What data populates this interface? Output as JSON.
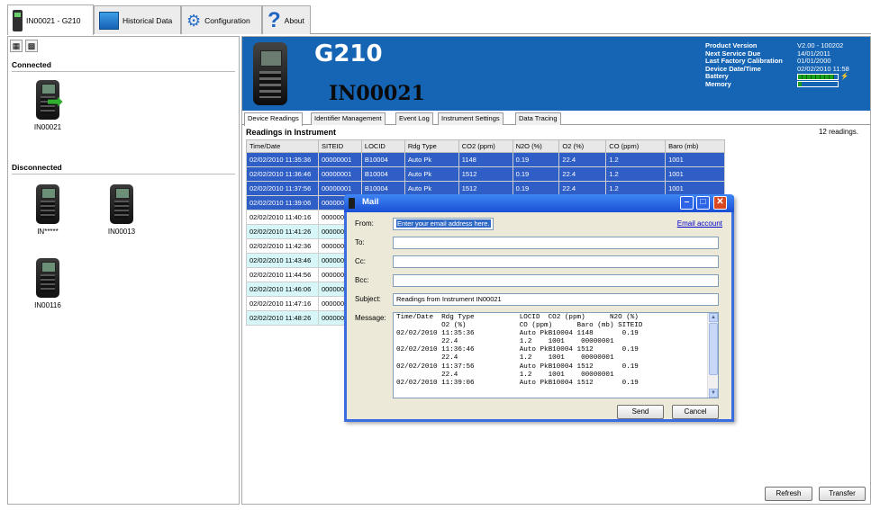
{
  "app": {
    "tabs": [
      {
        "label": "IN00021 - G210",
        "icon": "device-icon"
      },
      {
        "label": "Historical Data",
        "icon": "chart-icon"
      },
      {
        "label": "Configuration",
        "icon": "gear-icon"
      },
      {
        "label": "About",
        "icon": "help-icon"
      }
    ]
  },
  "left": {
    "connected_label": "Connected",
    "disconnected_label": "Disconnected",
    "connected": [
      {
        "label": "IN00021"
      }
    ],
    "disconnected": [
      {
        "label": "IN*****"
      },
      {
        "label": "IN00013"
      },
      {
        "label": "IN00116"
      }
    ]
  },
  "banner": {
    "model": "G210",
    "serial": "IN00021",
    "info": [
      {
        "key": "Product Version",
        "value": "V2.00 - 100202"
      },
      {
        "key": "Next Service Due",
        "value": "14/01/2011"
      },
      {
        "key": "Last Factory Calibration",
        "value": "01/01/2000"
      },
      {
        "key": "Device Date/Time",
        "value": "02/02/2010 11:58"
      },
      {
        "key": "Battery",
        "value": ""
      },
      {
        "key": "Memory",
        "value": ""
      }
    ],
    "battery_level": 0.9,
    "memory_level": 0.1
  },
  "subtabs": [
    "Device Readings",
    "Identifier Management",
    "Event Log",
    "Instrument Settings",
    "Data Tracing"
  ],
  "readings": {
    "title": "Readings in Instrument",
    "count": "12 readings.",
    "columns": [
      "Time/Date",
      "SITEID",
      "LOCID",
      "Rdg Type",
      "CO2 (ppm)",
      "N2O (%)",
      "O2 (%)",
      "CO (ppm)",
      "Baro (mb)"
    ],
    "rows": [
      [
        "02/02/2010 11:35:36",
        "00000001",
        "B10004",
        "Auto Pk",
        "1148",
        "0.19",
        "22.4",
        "1.2",
        "1001"
      ],
      [
        "02/02/2010 11:36:46",
        "00000001",
        "B10004",
        "Auto Pk",
        "1512",
        "0.19",
        "22.4",
        "1.2",
        "1001"
      ],
      [
        "02/02/2010 11:37:56",
        "00000001",
        "B10004",
        "Auto Pk",
        "1512",
        "0.19",
        "22.4",
        "1.2",
        "1001"
      ],
      [
        "02/02/2010 11:39:06",
        "000000",
        "",
        "",
        "",
        "",
        "",
        "",
        ""
      ],
      [
        "02/02/2010 11:40:16",
        "000000",
        "",
        "",
        "",
        "",
        "",
        "",
        ""
      ],
      [
        "02/02/2010 11:41:26",
        "000000",
        "",
        "",
        "",
        "",
        "",
        "",
        ""
      ],
      [
        "02/02/2010 11:42:36",
        "000000",
        "",
        "",
        "",
        "",
        "",
        "",
        ""
      ],
      [
        "02/02/2010 11:43:46",
        "000000",
        "",
        "",
        "",
        "",
        "",
        "",
        ""
      ],
      [
        "02/02/2010 11:44:56",
        "000000",
        "",
        "",
        "",
        "",
        "",
        "",
        ""
      ],
      [
        "02/02/2010 11:46:06",
        "000000",
        "",
        "",
        "",
        "",
        "",
        "",
        ""
      ],
      [
        "02/02/2010 11:47:16",
        "000000",
        "",
        "",
        "",
        "",
        "",
        "",
        ""
      ],
      [
        "02/02/2010 11:48:26",
        "000000",
        "",
        "",
        "",
        "",
        "",
        "",
        ""
      ]
    ],
    "row_styles": [
      "sel",
      "sel",
      "sel",
      "sel",
      "",
      "cyan",
      "",
      "cyan",
      "",
      "cyan",
      "",
      "cyan"
    ]
  },
  "buttons": {
    "refresh": "Refresh",
    "transfer": "Transfer"
  },
  "mail": {
    "title": "Mail",
    "from_label": "From:",
    "from_value": "Enter your email address here.",
    "email_account": "Email account",
    "to_label": "To:",
    "cc_label": "Cc:",
    "bcc_label": "Bcc:",
    "subject_label": "Subject:",
    "subject_value": "Readings from Instrument IN00021",
    "message_label": "Message:",
    "message": "Time/Date  Rdg Type           LOCID  CO2 (ppm)      N2O (%)\n           O2 (%)             CO (ppm)      Baro (mb) SITEID\n02/02/2010 11:35:36           Auto PkB10004 1148       0.19\n           22.4               1.2    1001    00000001\n02/02/2010 11:36:46           Auto PkB10004 1512       0.19\n           22.4               1.2    1001    00000001\n02/02/2010 11:37:56           Auto PkB10004 1512       0.19\n           22.4               1.2    1001    00000001\n02/02/2010 11:39:06           Auto PkB10004 1512       0.19",
    "send": "Send",
    "cancel": "Cancel"
  }
}
